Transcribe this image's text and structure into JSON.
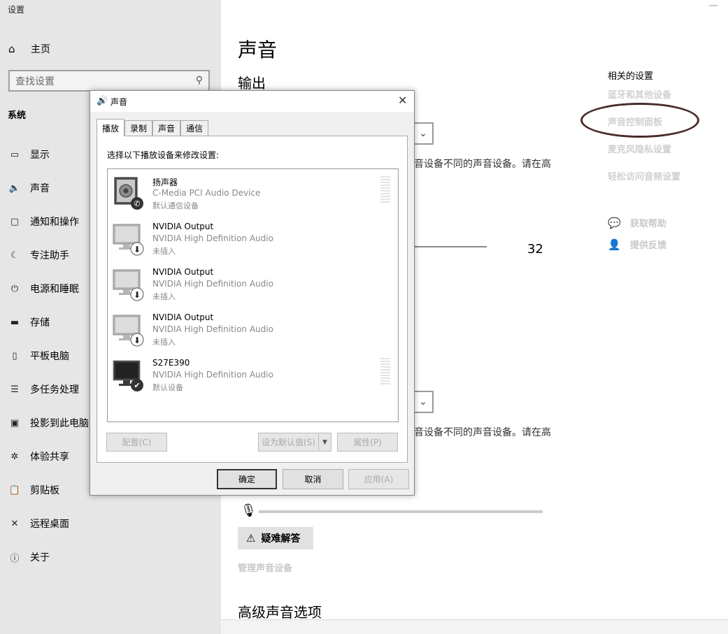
{
  "window": {
    "title": "设置",
    "minimize_glyph": "—"
  },
  "sidebar": {
    "home": {
      "icon": "home-icon",
      "glyph": "⌂",
      "label": "主页"
    },
    "search": {
      "placeholder": "查找设置",
      "icon": "search-icon",
      "glyph": "⚲"
    },
    "group_label": "系统",
    "items": [
      {
        "icon": "display-icon",
        "glyph": "▭",
        "label": "显示"
      },
      {
        "icon": "sound-icon",
        "glyph": "🔈",
        "label": "声音"
      },
      {
        "icon": "notification-icon",
        "glyph": "▢",
        "label": "通知和操作"
      },
      {
        "icon": "focus-assist-icon",
        "glyph": "☾",
        "label": "专注助手"
      },
      {
        "icon": "power-icon",
        "glyph": "⏻",
        "label": "电源和睡眠"
      },
      {
        "icon": "storage-icon",
        "glyph": "▬",
        "label": "存储"
      },
      {
        "icon": "tablet-icon",
        "glyph": "▯",
        "label": "平板电脑"
      },
      {
        "icon": "multitasking-icon",
        "glyph": "☰",
        "label": "多任务处理"
      },
      {
        "icon": "project-icon",
        "glyph": "▣",
        "label": "投影到此电脑"
      },
      {
        "icon": "shared-experience-icon",
        "glyph": "✲",
        "label": "体验共享"
      },
      {
        "icon": "clipboard-icon",
        "glyph": "📋",
        "label": "剪贴板"
      },
      {
        "icon": "remote-desktop-icon",
        "glyph": "✕",
        "label": "远程桌面"
      },
      {
        "icon": "about-icon",
        "glyph": "ⓘ",
        "label": "关于"
      }
    ]
  },
  "content": {
    "title": "声音",
    "output_heading": "输出",
    "hint_partial": "音设备不同的声音设备。请在高",
    "volume_value": "32",
    "troubleshoot_label": "疑难解答",
    "troubleshoot_icon": "warning-icon",
    "troubleshoot_glyph": "⚠",
    "manage_devices": "管理声音设备",
    "advanced_heading": "高级声音选项",
    "mic_glyph": "🎙",
    "chevron_glyph": "⌄"
  },
  "related": {
    "title": "相关的设置",
    "links": [
      "蓝牙和其他设备",
      "声音控制面板",
      "麦克风隐私设置",
      "轻松访问音频设置"
    ],
    "help": [
      {
        "icon": "help-icon",
        "glyph": "💬",
        "label": "获取帮助"
      },
      {
        "icon": "feedback-icon",
        "glyph": "👤",
        "label": "提供反馈"
      }
    ]
  },
  "dialog": {
    "title": "声音",
    "title_glyph": "🔊",
    "close_glyph": "✕",
    "tabs": [
      "播放",
      "录制",
      "声音",
      "通信"
    ],
    "active_tab": "播放",
    "instruction": "选择以下播放设备来修改设置:",
    "devices": [
      {
        "name": "扬声器",
        "desc": "C-Media PCI Audio Device",
        "status": "默认通信设备",
        "type": "speaker",
        "badge": "phone"
      },
      {
        "name": "NVIDIA Output",
        "desc": "NVIDIA High Definition Audio",
        "status": "未插入",
        "type": "monitor-disabled",
        "badge": "unplugged"
      },
      {
        "name": "NVIDIA Output",
        "desc": "NVIDIA High Definition Audio",
        "status": "未插入",
        "type": "monitor-disabled",
        "badge": "unplugged"
      },
      {
        "name": "NVIDIA Output",
        "desc": "NVIDIA High Definition Audio",
        "status": "未插入",
        "type": "monitor-disabled",
        "badge": "unplugged"
      },
      {
        "name": "S27E390",
        "desc": "NVIDIA High Definition Audio",
        "status": "默认设备",
        "type": "monitor",
        "badge": "check"
      }
    ],
    "buttons": {
      "configure": "配置(C)",
      "set_default": "设为默认值(S)",
      "properties": "属性(P)",
      "ok": "确定",
      "cancel": "取消",
      "apply": "应用(A)",
      "dropdown_glyph": "▼"
    }
  }
}
